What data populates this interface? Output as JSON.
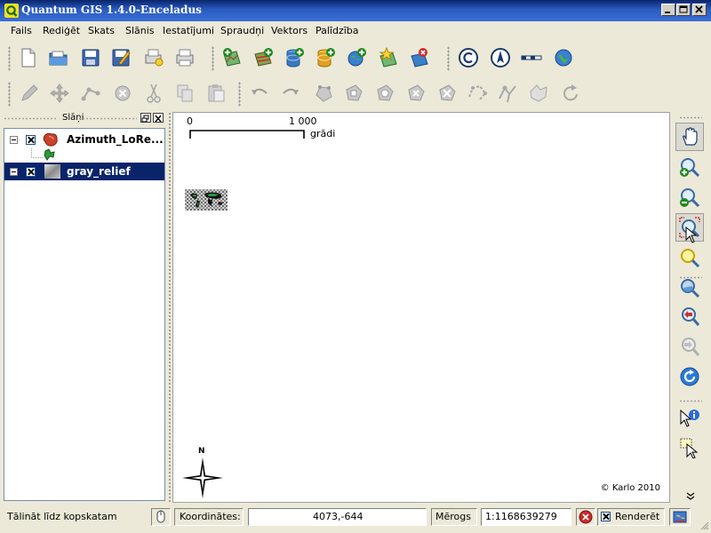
{
  "window": {
    "title": "Quantum GIS 1.4.0-Enceladus"
  },
  "menu": [
    "Fails",
    "Rediģēt",
    "Skats",
    "Slānis",
    "Iestatījumi",
    "Spraudņi",
    "Vektors",
    "Palīdzība"
  ],
  "toolbar_file": [
    "new-project-icon",
    "open-project-icon",
    "save-project-icon",
    "save-as-icon",
    "print-composer-icon",
    "print-icon"
  ],
  "toolbar_layers": [
    "add-vector-layer-icon",
    "add-raster-layer-icon",
    "add-postgis-layer-icon",
    "add-spatialite-layer-icon",
    "add-wms-layer-icon",
    "new-vector-layer-icon",
    "remove-layer-icon"
  ],
  "toolbar_plugins": [
    "copyright-icon",
    "north-arrow-icon",
    "scale-bar-icon",
    "gps-globe-icon"
  ],
  "toolbar_edit": [
    "toggle-editing-icon",
    "capture-point-icon",
    "capture-line-icon",
    "capture-polygon-icon",
    "move-feature-icon",
    "node-tool-icon",
    "delete-selected-icon",
    "cut-features-icon",
    "copy-features-icon",
    "paste-features-icon",
    "undo-icon",
    "redo-icon",
    "simplify-feature-icon",
    "add-ring-icon",
    "add-island-icon",
    "delete-ring-icon",
    "delete-part-icon",
    "reshape-features-icon",
    "split-features-icon",
    "merge-features-icon",
    "rotate-icon"
  ],
  "layers_panel": {
    "title": "Slāņi",
    "layers": [
      {
        "name": "Azimuth_LoRe...",
        "selected": false
      },
      {
        "name": "gray_relief",
        "selected": true
      }
    ]
  },
  "map": {
    "scale_bar": {
      "start": "0",
      "end": "1 000",
      "unit": "grādi"
    },
    "north_arrow": "N",
    "copyright": "© Karlo 2010"
  },
  "nav_tools": [
    "pan-icon",
    "zoom-in-icon",
    "zoom-out-icon",
    "zoom-full-icon",
    "zoom-to-selection-icon",
    "zoom-to-layer-icon",
    "zoom-last-icon",
    "zoom-next-icon",
    "refresh-icon",
    "identify-icon",
    "select-icon"
  ],
  "statusbar": {
    "message": "Tālināt līdz kopskatam",
    "coord_label": "Koordinātes:",
    "coord_value": "4073,-644",
    "scale_label": "Mērogs",
    "scale_value": "1:1168639279",
    "render_label": "Renderēt"
  },
  "colors": {
    "titlebar": "#0a246a",
    "selection": "#0a246a",
    "panel_bg": "#ece9d8"
  }
}
